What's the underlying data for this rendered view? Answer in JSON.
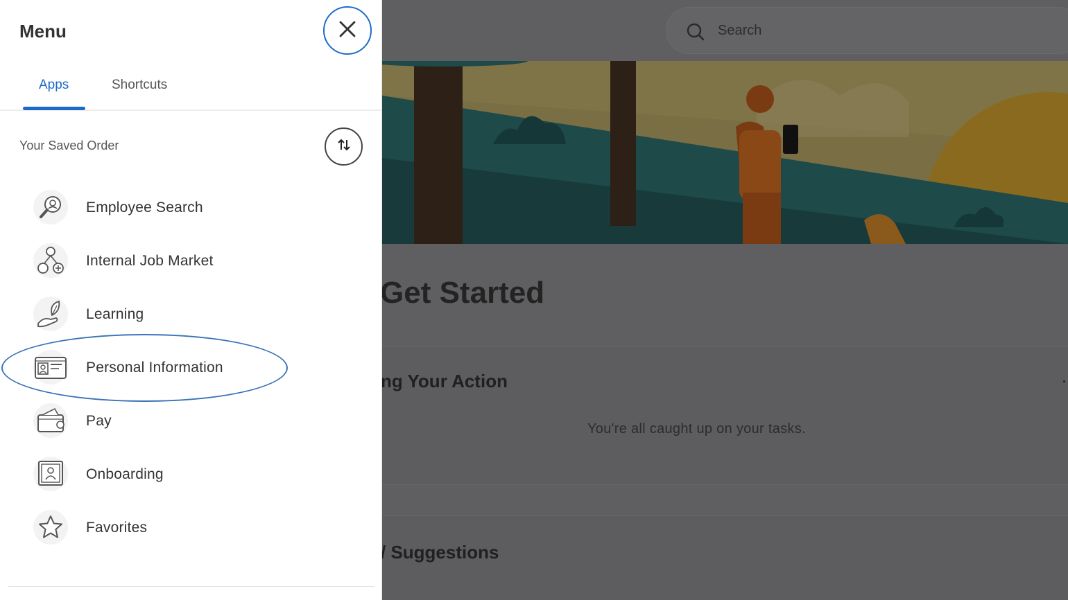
{
  "menu": {
    "title": "Menu",
    "close_icon": "close-icon",
    "tabs": [
      {
        "label": "Apps",
        "active": true
      },
      {
        "label": "Shortcuts",
        "active": false
      }
    ],
    "saved_order_label": "Your Saved Order",
    "reorder_icon": "sort-arrows-icon",
    "apps": [
      {
        "label": "Employee Search",
        "icon": "magnifier-person-icon"
      },
      {
        "label": "Internal Job Market",
        "icon": "people-network-icon"
      },
      {
        "label": "Learning",
        "icon": "hand-feather-icon"
      },
      {
        "label": "Personal Information",
        "icon": "id-card-icon",
        "highlighted": true
      },
      {
        "label": "Pay",
        "icon": "wallet-icon"
      },
      {
        "label": "Onboarding",
        "icon": "badge-icon"
      },
      {
        "label": "Favorites",
        "icon": "star-icon"
      }
    ],
    "accent_color": "#1b6ac9"
  },
  "background": {
    "search_placeholder": "Search",
    "title": "Get Started",
    "cards": [
      {
        "heading": "ng Your Action",
        "message": "You're all caught up on your tasks."
      },
      {
        "heading": "/ Suggestions"
      }
    ]
  }
}
